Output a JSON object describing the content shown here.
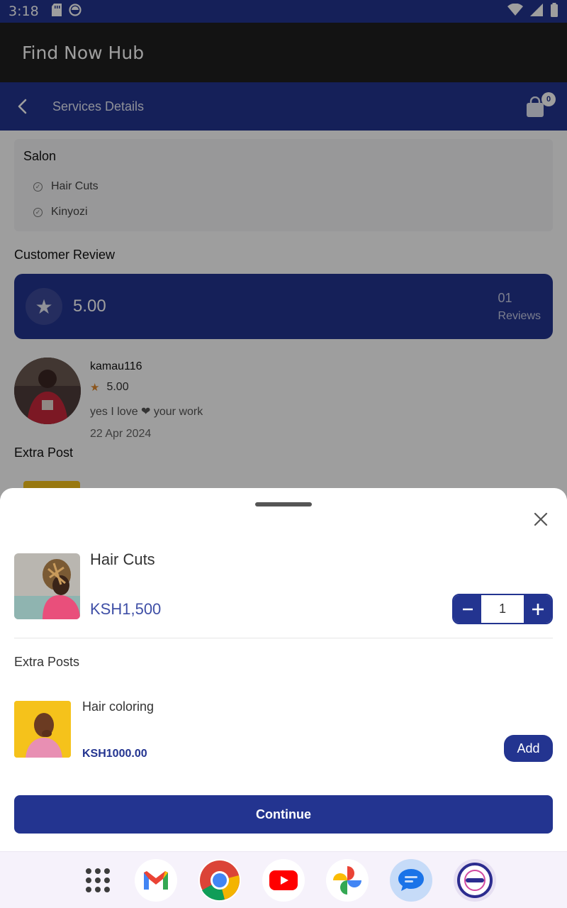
{
  "status_bar": {
    "time": "3:18"
  },
  "app": {
    "title": "Find Now Hub"
  },
  "header": {
    "title": "Services Details",
    "cart_count": "0"
  },
  "service": {
    "category": "Salon",
    "items": [
      "Hair Cuts",
      "Kinyozi"
    ]
  },
  "reviews": {
    "section_title": "Customer Review",
    "average": "5.00",
    "count": "01",
    "count_label": "Reviews",
    "list": [
      {
        "name": "kamau116",
        "rating": "5.00",
        "comment": "yes I love ❤ your work",
        "date": "22 Apr 2024"
      }
    ]
  },
  "extra_post_title": "Extra Post",
  "sheet": {
    "item_name": "Hair Cuts",
    "item_price": "KSH1,500",
    "quantity": "1",
    "extra_title": "Extra Posts",
    "extras": [
      {
        "name": "Hair coloring",
        "price": "KSH1000.00",
        "button": "Add"
      }
    ],
    "continue_label": "Continue"
  },
  "dock": {
    "apps": [
      "app-drawer-icon",
      "gmail-icon",
      "chrome-icon",
      "youtube-icon",
      "photos-icon",
      "messages-icon",
      "findnow-app-icon"
    ]
  },
  "colors": {
    "primary": "#233490",
    "appbar": "#1f1f20",
    "accent_price": "#3f4fa6",
    "star": "#e08a2e"
  }
}
